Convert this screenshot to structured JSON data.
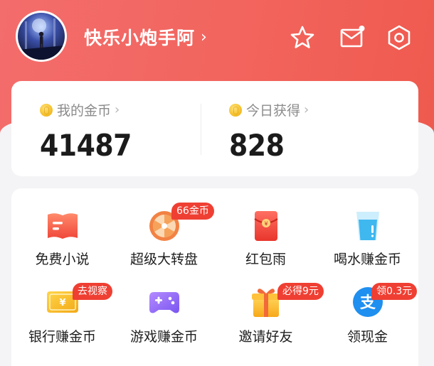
{
  "profile": {
    "username": "快乐小炮手阿",
    "chevron": "›"
  },
  "header_icons": [
    "star-icon",
    "message-icon",
    "settings-icon"
  ],
  "coins": {
    "my_coins_label": "我的金币",
    "my_coins_value": "41487",
    "today_label": "今日获得",
    "today_value": "828",
    "chevron": "›"
  },
  "tasks": [
    {
      "label": "免费小说",
      "icon": "book-icon",
      "badge": ""
    },
    {
      "label": "超级大转盘",
      "icon": "wheel-icon",
      "badge": "66金币"
    },
    {
      "label": "红包雨",
      "icon": "red-envelope-icon",
      "badge": ""
    },
    {
      "label": "喝水赚金币",
      "icon": "water-cup-icon",
      "badge": ""
    },
    {
      "label": "银行赚金币",
      "icon": "bank-card-icon",
      "badge": "去视察"
    },
    {
      "label": "游戏赚金币",
      "icon": "gamepad-icon",
      "badge": ""
    },
    {
      "label": "邀请好友",
      "icon": "gift-icon",
      "badge": "必得9元"
    },
    {
      "label": "领现金",
      "icon": "alipay-icon",
      "badge": "领0.3元"
    }
  ],
  "colors": {
    "header": "#f2645d",
    "badge": "#ef3f33",
    "coin": "#f5c02c"
  }
}
